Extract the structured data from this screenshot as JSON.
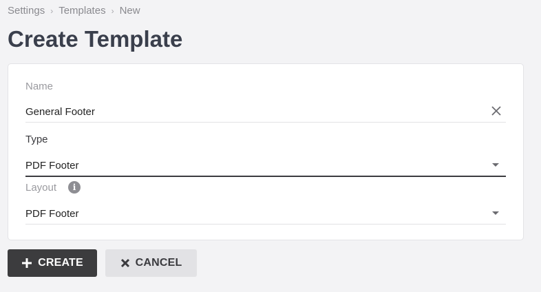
{
  "breadcrumb": {
    "items": [
      "Settings",
      "Templates",
      "New"
    ],
    "separator": "›"
  },
  "page": {
    "title": "Create Template"
  },
  "form": {
    "name": {
      "label": "Name",
      "value": "General Footer"
    },
    "type": {
      "label": "Type",
      "value": "PDF Footer"
    },
    "layout": {
      "label": "Layout",
      "value": "PDF Footer",
      "info": "i"
    }
  },
  "actions": {
    "create_label": "CREATE",
    "cancel_label": "CANCEL"
  },
  "icons": {
    "clear": "close-icon",
    "dropdown": "chevron-down-icon",
    "info": "info-icon",
    "create": "plus-icon",
    "cancel": "close-icon"
  },
  "colors": {
    "background": "#f3f3f5",
    "primary_button": "#3c3c3e",
    "secondary_button": "#e2e2e5",
    "title": "#3a3f4c"
  }
}
